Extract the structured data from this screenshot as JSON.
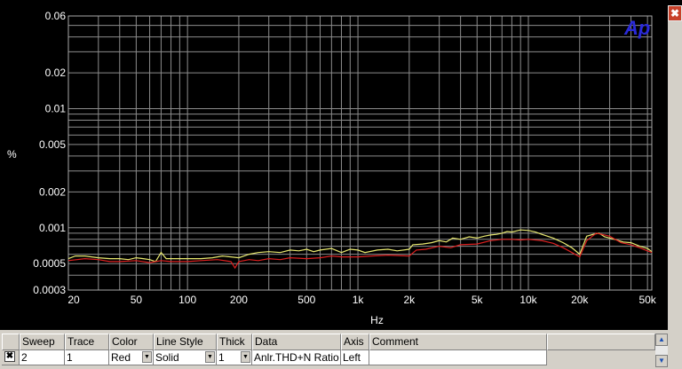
{
  "chart_data": {
    "type": "line",
    "title": "",
    "xlabel": "Hz",
    "ylabel": "%",
    "xscale": "log",
    "yscale": "log",
    "xlim": [
      20,
      53000
    ],
    "ylim": [
      0.0003,
      0.06
    ],
    "grid": true,
    "x_ticks": [
      {
        "value": 20,
        "label": "20"
      },
      {
        "value": 50,
        "label": "50"
      },
      {
        "value": 100,
        "label": "100"
      },
      {
        "value": 200,
        "label": "200"
      },
      {
        "value": 500,
        "label": "500"
      },
      {
        "value": 1000,
        "label": "1k"
      },
      {
        "value": 2000,
        "label": "2k"
      },
      {
        "value": 5000,
        "label": "5k"
      },
      {
        "value": 10000,
        "label": "10k"
      },
      {
        "value": 20000,
        "label": "20k"
      },
      {
        "value": 50000,
        "label": "50k"
      }
    ],
    "y_ticks": [
      {
        "value": 0.0003,
        "label": "0.0003"
      },
      {
        "value": 0.0005,
        "label": "0.0005"
      },
      {
        "value": 0.001,
        "label": "0.001"
      },
      {
        "value": 0.002,
        "label": "0.002"
      },
      {
        "value": 0.005,
        "label": "0.005"
      },
      {
        "value": 0.01,
        "label": "0.01"
      },
      {
        "value": 0.02,
        "label": "0.02"
      },
      {
        "value": 0.06,
        "label": "0.06"
      }
    ],
    "series": [
      {
        "color": "#e8e870",
        "points": [
          [
            20,
            0.00055
          ],
          [
            22,
            0.00058
          ],
          [
            25,
            0.00058
          ],
          [
            30,
            0.00056
          ],
          [
            35,
            0.00055
          ],
          [
            40,
            0.00055
          ],
          [
            45,
            0.00054
          ],
          [
            50,
            0.00056
          ],
          [
            55,
            0.00055
          ],
          [
            60,
            0.00054
          ],
          [
            65,
            0.00052
          ],
          [
            70,
            0.00062
          ],
          [
            75,
            0.00055
          ],
          [
            80,
            0.00055
          ],
          [
            90,
            0.00055
          ],
          [
            100,
            0.00055
          ],
          [
            120,
            0.00055
          ],
          [
            140,
            0.00056
          ],
          [
            160,
            0.00058
          ],
          [
            180,
            0.00057
          ],
          [
            200,
            0.00056
          ],
          [
            230,
            0.0006
          ],
          [
            260,
            0.00062
          ],
          [
            300,
            0.00063
          ],
          [
            350,
            0.00062
          ],
          [
            400,
            0.00065
          ],
          [
            450,
            0.00064
          ],
          [
            500,
            0.00066
          ],
          [
            550,
            0.00063
          ],
          [
            600,
            0.00065
          ],
          [
            700,
            0.00067
          ],
          [
            800,
            0.00062
          ],
          [
            900,
            0.00066
          ],
          [
            1000,
            0.00065
          ],
          [
            1100,
            0.00062
          ],
          [
            1300,
            0.00065
          ],
          [
            1500,
            0.00066
          ],
          [
            1700,
            0.00064
          ],
          [
            2000,
            0.00066
          ],
          [
            2100,
            0.00072
          ],
          [
            2400,
            0.00073
          ],
          [
            2700,
            0.00075
          ],
          [
            3000,
            0.00078
          ],
          [
            3300,
            0.00076
          ],
          [
            3600,
            0.00082
          ],
          [
            4000,
            0.0008
          ],
          [
            4500,
            0.00084
          ],
          [
            5000,
            0.00082
          ],
          [
            5500,
            0.00085
          ],
          [
            6000,
            0.00087
          ],
          [
            6500,
            0.00088
          ],
          [
            7000,
            0.0009
          ],
          [
            7500,
            0.00093
          ],
          [
            8000,
            0.00092
          ],
          [
            9000,
            0.00096
          ],
          [
            10000,
            0.00095
          ],
          [
            11000,
            0.00092
          ],
          [
            12000,
            0.00088
          ],
          [
            14000,
            0.00082
          ],
          [
            16000,
            0.00075
          ],
          [
            18000,
            0.00068
          ],
          [
            20000,
            0.0006
          ],
          [
            22000,
            0.00085
          ],
          [
            24000,
            0.00088
          ],
          [
            26000,
            0.0009
          ],
          [
            28000,
            0.00084
          ],
          [
            32000,
            0.0008
          ],
          [
            36000,
            0.00076
          ],
          [
            40000,
            0.00075
          ],
          [
            45000,
            0.0007
          ],
          [
            50000,
            0.00067
          ],
          [
            53000,
            0.00063
          ]
        ]
      },
      {
        "color": "#dd2020",
        "points": [
          [
            20,
            0.00053
          ],
          [
            25,
            0.00055
          ],
          [
            30,
            0.00054
          ],
          [
            35,
            0.00052
          ],
          [
            40,
            0.00052
          ],
          [
            50,
            0.00053
          ],
          [
            60,
            0.00051
          ],
          [
            70,
            0.00053
          ],
          [
            80,
            0.00052
          ],
          [
            100,
            0.00052
          ],
          [
            120,
            0.00053
          ],
          [
            150,
            0.00054
          ],
          [
            180,
            0.00052
          ],
          [
            190,
            0.00046
          ],
          [
            200,
            0.00052
          ],
          [
            230,
            0.00054
          ],
          [
            260,
            0.00053
          ],
          [
            300,
            0.00055
          ],
          [
            350,
            0.00054
          ],
          [
            400,
            0.00056
          ],
          [
            500,
            0.00055
          ],
          [
            600,
            0.00056
          ],
          [
            700,
            0.00058
          ],
          [
            800,
            0.00057
          ],
          [
            1000,
            0.00057
          ],
          [
            1200,
            0.00058
          ],
          [
            1500,
            0.00059
          ],
          [
            2000,
            0.00058
          ],
          [
            2200,
            0.00065
          ],
          [
            2500,
            0.00066
          ],
          [
            3000,
            0.0007
          ],
          [
            3500,
            0.00068
          ],
          [
            4000,
            0.00072
          ],
          [
            5000,
            0.00073
          ],
          [
            6000,
            0.00078
          ],
          [
            7000,
            0.0008
          ],
          [
            8000,
            0.0008
          ],
          [
            9000,
            0.00079
          ],
          [
            10000,
            0.0008
          ],
          [
            12000,
            0.00078
          ],
          [
            14000,
            0.00074
          ],
          [
            16000,
            0.00068
          ],
          [
            18000,
            0.00062
          ],
          [
            20000,
            0.00057
          ],
          [
            22000,
            0.00078
          ],
          [
            25000,
            0.0009
          ],
          [
            27000,
            0.00088
          ],
          [
            30000,
            0.00085
          ],
          [
            35000,
            0.00075
          ],
          [
            40000,
            0.00072
          ],
          [
            45000,
            0.00068
          ],
          [
            50000,
            0.00064
          ],
          [
            53000,
            0.00062
          ]
        ]
      }
    ],
    "table": {
      "headers": [
        "Sweep",
        "Trace",
        "Color",
        "Line Style",
        "Thick",
        "Data",
        "Axis",
        "Comment"
      ],
      "row": {
        "checked": "✖",
        "sweep": "2",
        "trace": "1",
        "color": "Red",
        "line_style": "Solid",
        "thick": "1",
        "data": "Anlr.THD+N Ratio",
        "axis": "Left",
        "comment": ""
      }
    }
  },
  "ui": {
    "logo": "Ap",
    "close_glyph": "✖",
    "scroll_up": "▲",
    "scroll_down": "▼",
    "dropdown_glyph": "▼"
  }
}
